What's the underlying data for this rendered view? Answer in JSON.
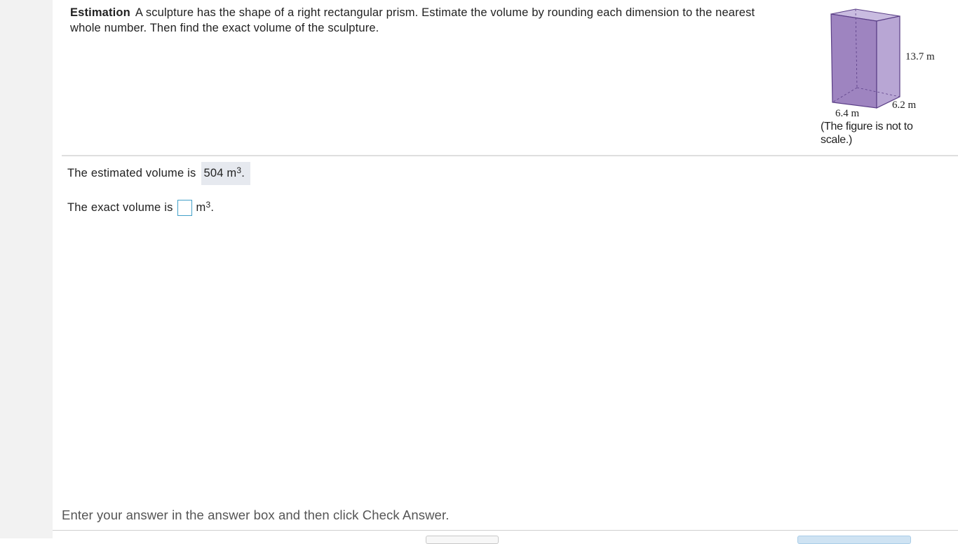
{
  "question": {
    "lead": "Estimation",
    "text": "A sculpture has the shape of a right rectangular prism. Estimate the volume by rounding each dimension to the nearest whole number. Then find the exact volume of the sculpture."
  },
  "figure": {
    "height_label": "13.7 m",
    "depth_label": "6.2 m",
    "width_label": "6.4 m",
    "caption": "(The figure is not to scale.)",
    "colors": {
      "front_face": "#9e84c0",
      "side_face": "#b8a6d4",
      "top_face": "#c9bce0",
      "edge": "#5a3e86"
    }
  },
  "answers": {
    "estimated_prefix": "The estimated volume is",
    "estimated_value": "504",
    "estimated_unit": "m",
    "estimated_exponent": "3",
    "estimated_suffix": ".",
    "exact_prefix": "The exact volume is",
    "exact_value": "",
    "exact_unit": "m",
    "exact_exponent": "3",
    "exact_suffix": "."
  },
  "instructions": "Enter your answer in the answer box and then click Check Answer."
}
